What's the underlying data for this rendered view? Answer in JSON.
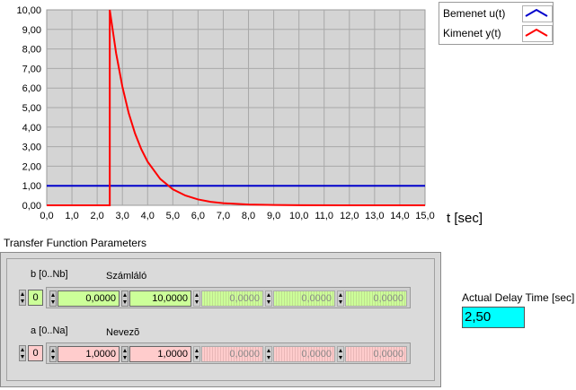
{
  "chart_data": {
    "type": "line",
    "xlabel": "t [sec]",
    "xlim": [
      0,
      15
    ],
    "ylim": [
      0,
      10
    ],
    "x_ticks": [
      "0,0",
      "1,0",
      "2,0",
      "3,0",
      "4,0",
      "5,0",
      "6,0",
      "7,0",
      "8,0",
      "9,0",
      "10,0",
      "11,0",
      "12,0",
      "13,0",
      "14,0",
      "15,0"
    ],
    "y_ticks": [
      "0,00",
      "1,00",
      "2,00",
      "3,00",
      "4,00",
      "5,00",
      "6,00",
      "7,00",
      "8,00",
      "9,00",
      "10,00"
    ],
    "grid": true,
    "legend_position": "top-right",
    "series": [
      {
        "name": "Bemenet u(t)",
        "color": "#0000cc",
        "x": [
          0,
          15
        ],
        "y": [
          1,
          1
        ]
      },
      {
        "name": "Kimenet y(t)",
        "color": "#ff0000",
        "x": [
          0,
          2.5,
          2.5,
          2.75,
          3.0,
          3.25,
          3.5,
          3.75,
          4.0,
          4.5,
          5.0,
          5.5,
          6.0,
          6.5,
          7.0,
          8.0,
          9.0,
          10.0,
          12.0,
          15.0
        ],
        "y": [
          0,
          0,
          10.0,
          7.79,
          6.07,
          4.72,
          3.68,
          2.87,
          2.23,
          1.35,
          0.82,
          0.5,
          0.3,
          0.18,
          0.11,
          0.04,
          0.015,
          0.005,
          0.0,
          0.0
        ]
      }
    ]
  },
  "legend": {
    "items": [
      {
        "label": "Bemenet u(t)",
        "color": "#0000cc"
      },
      {
        "label": "Kimenet y(t)",
        "color": "#ff0000"
      }
    ]
  },
  "params": {
    "title": "Transfer Function Parameters",
    "b": {
      "index_label": "b [0..Nb]",
      "array_label": "Számláló",
      "index": "0",
      "values": [
        "0,0000",
        "10,0000",
        "0,0000",
        "0,0000",
        "0,0000"
      ]
    },
    "a": {
      "index_label": "a [0..Na]",
      "array_label": "Nevezõ",
      "index": "0",
      "values": [
        "1,0000",
        "1,0000",
        "0,0000",
        "0,0000",
        "0,0000"
      ]
    }
  },
  "delay": {
    "label": "Actual Delay Time [sec]",
    "value": "2,50"
  }
}
